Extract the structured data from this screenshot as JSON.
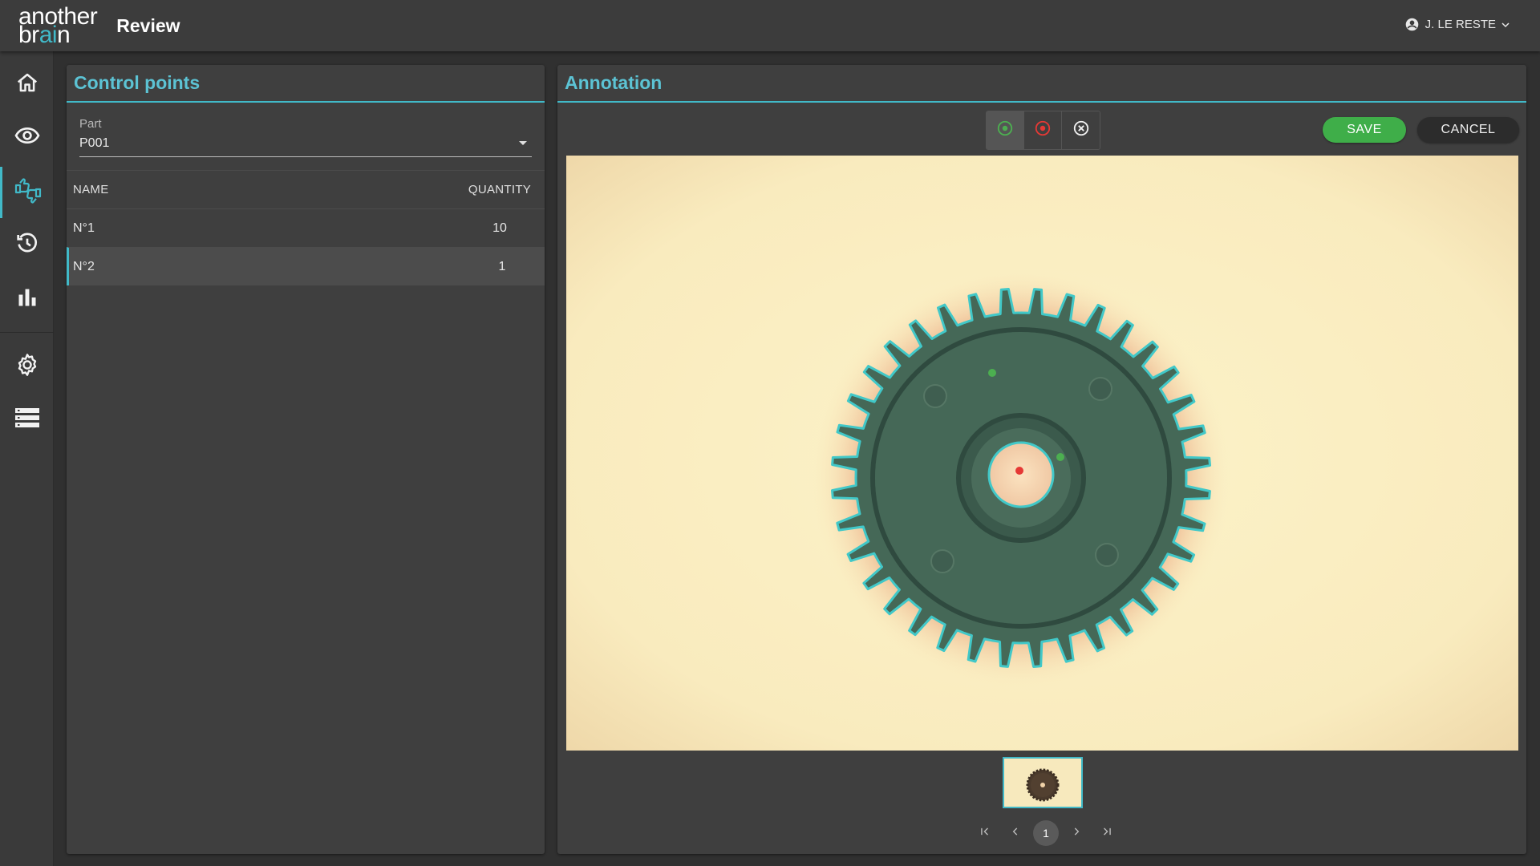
{
  "header": {
    "logo_line1": "another",
    "logo_line2_a": "br",
    "logo_line2_b": "ai",
    "logo_line2_c": "n",
    "page_title": "Review",
    "user_name": "J. LE RESTE",
    "user_icon": "account-circle-icon",
    "dropdown_icon": "chevron-down-icon"
  },
  "sidebar": {
    "items": [
      {
        "name": "home",
        "icon": "home-icon"
      },
      {
        "name": "inspect",
        "icon": "eye-icon"
      },
      {
        "name": "review",
        "icon": "thumbs-review-icon",
        "active": true
      },
      {
        "name": "history",
        "icon": "history-icon"
      },
      {
        "name": "statistics",
        "icon": "bar-chart-icon"
      },
      {
        "name": "settings",
        "icon": "gear-icon"
      },
      {
        "name": "list",
        "icon": "list-icon"
      }
    ]
  },
  "control_points": {
    "title": "Control points",
    "part_label": "Part",
    "part_value": "P001",
    "columns": {
      "name": "NAME",
      "quantity": "QUANTITY"
    },
    "rows": [
      {
        "name": "N°1",
        "quantity": "10",
        "selected": false
      },
      {
        "name": "N°2",
        "quantity": "1",
        "selected": true
      }
    ]
  },
  "annotation": {
    "title": "Annotation",
    "tools": [
      {
        "name": "good-marker",
        "icon": "target-green-icon",
        "active": true
      },
      {
        "name": "bad-marker",
        "icon": "target-red-icon",
        "active": false
      },
      {
        "name": "clear-marker",
        "icon": "close-circle-icon",
        "active": false
      }
    ],
    "save_label": "SAVE",
    "cancel_label": "CANCEL",
    "image_subject": "gear",
    "pager": {
      "current_page": "1"
    }
  },
  "colors": {
    "accent": "#41b9c8",
    "save": "#3fae49",
    "good_marker": "#4caf50",
    "bad_marker": "#e53935"
  }
}
